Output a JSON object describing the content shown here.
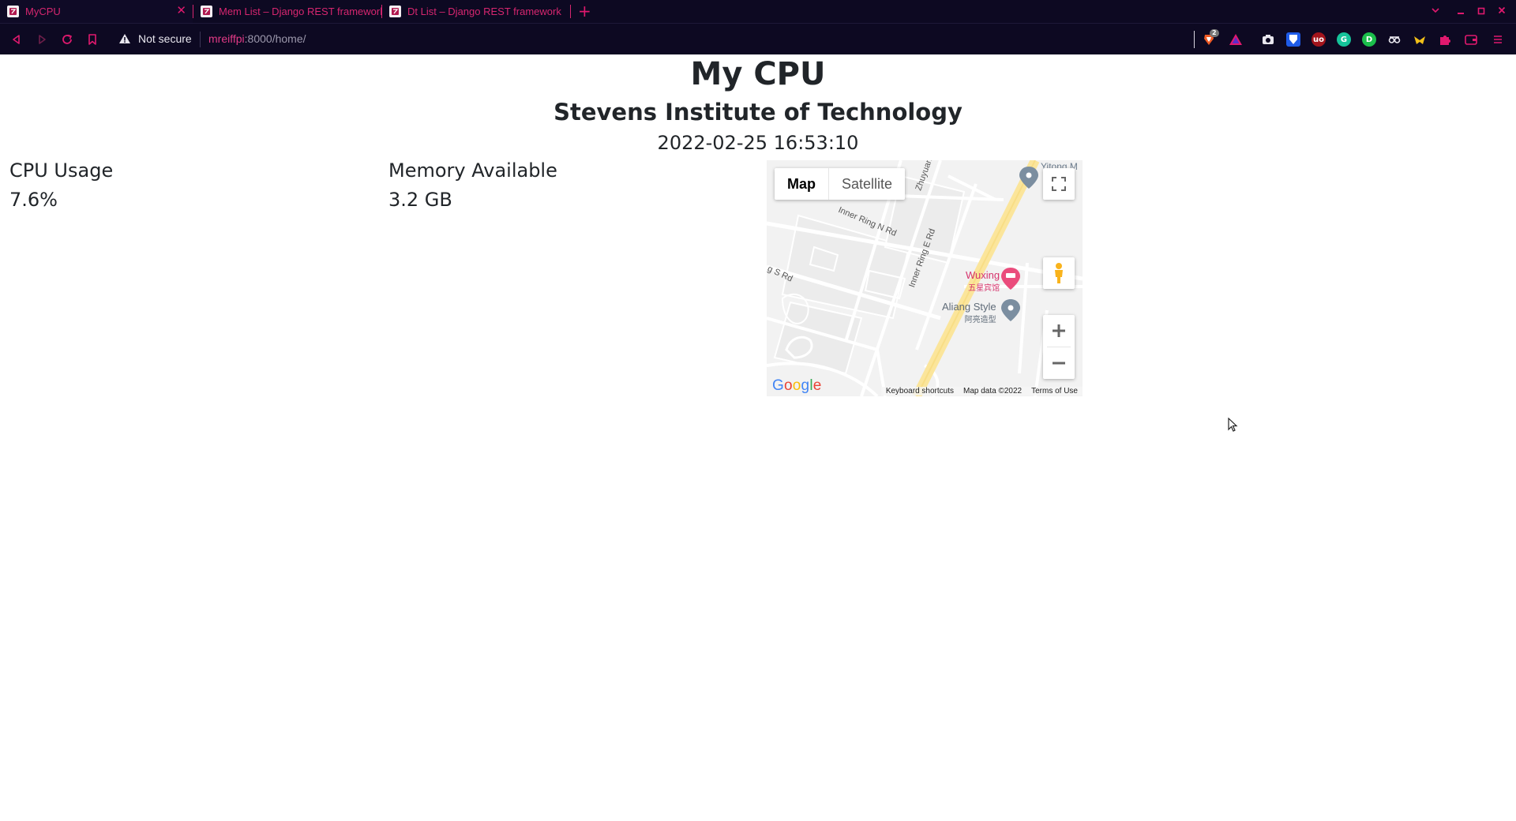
{
  "browser": {
    "tabs": [
      {
        "title": "MyCPU",
        "active": true
      },
      {
        "title": "Mem List – Django REST framework",
        "active": false
      },
      {
        "title": "Dt List – Django REST framework",
        "active": false
      }
    ],
    "security_label": "Not secure",
    "url_host": "mreiffpi",
    "url_rest": ":8000/home/",
    "extension_badge": "2",
    "accent_color": "#e0196e",
    "chrome_color": "#0d0922"
  },
  "page": {
    "title": "My CPU",
    "subtitle": "Stevens Institute of Technology",
    "timestamp": "2022-02-25 16:53:10",
    "stats": {
      "cpu": {
        "label": "CPU Usage",
        "value": "7.6%"
      },
      "memory": {
        "label": "Memory Available",
        "value": "3.2 GB"
      }
    }
  },
  "map": {
    "type_map": "Map",
    "type_satellite": "Satellite",
    "selected_type": "Map",
    "streets": [
      "Inner Ring N Rd",
      "Inner Ring E Rd",
      "Zhuyuan",
      "g S Rd"
    ],
    "poi_hotel_name": "Wuxing",
    "poi_hotel_cn": "五星宾馆",
    "poi_style_name": "Aliang Style",
    "poi_style_cn": "阿亮造型",
    "poi_top": "Yitong M",
    "footer": {
      "shortcuts": "Keyboard shortcuts",
      "data": "Map data ©2022",
      "terms": "Terms of Use"
    },
    "logo": "Google"
  }
}
